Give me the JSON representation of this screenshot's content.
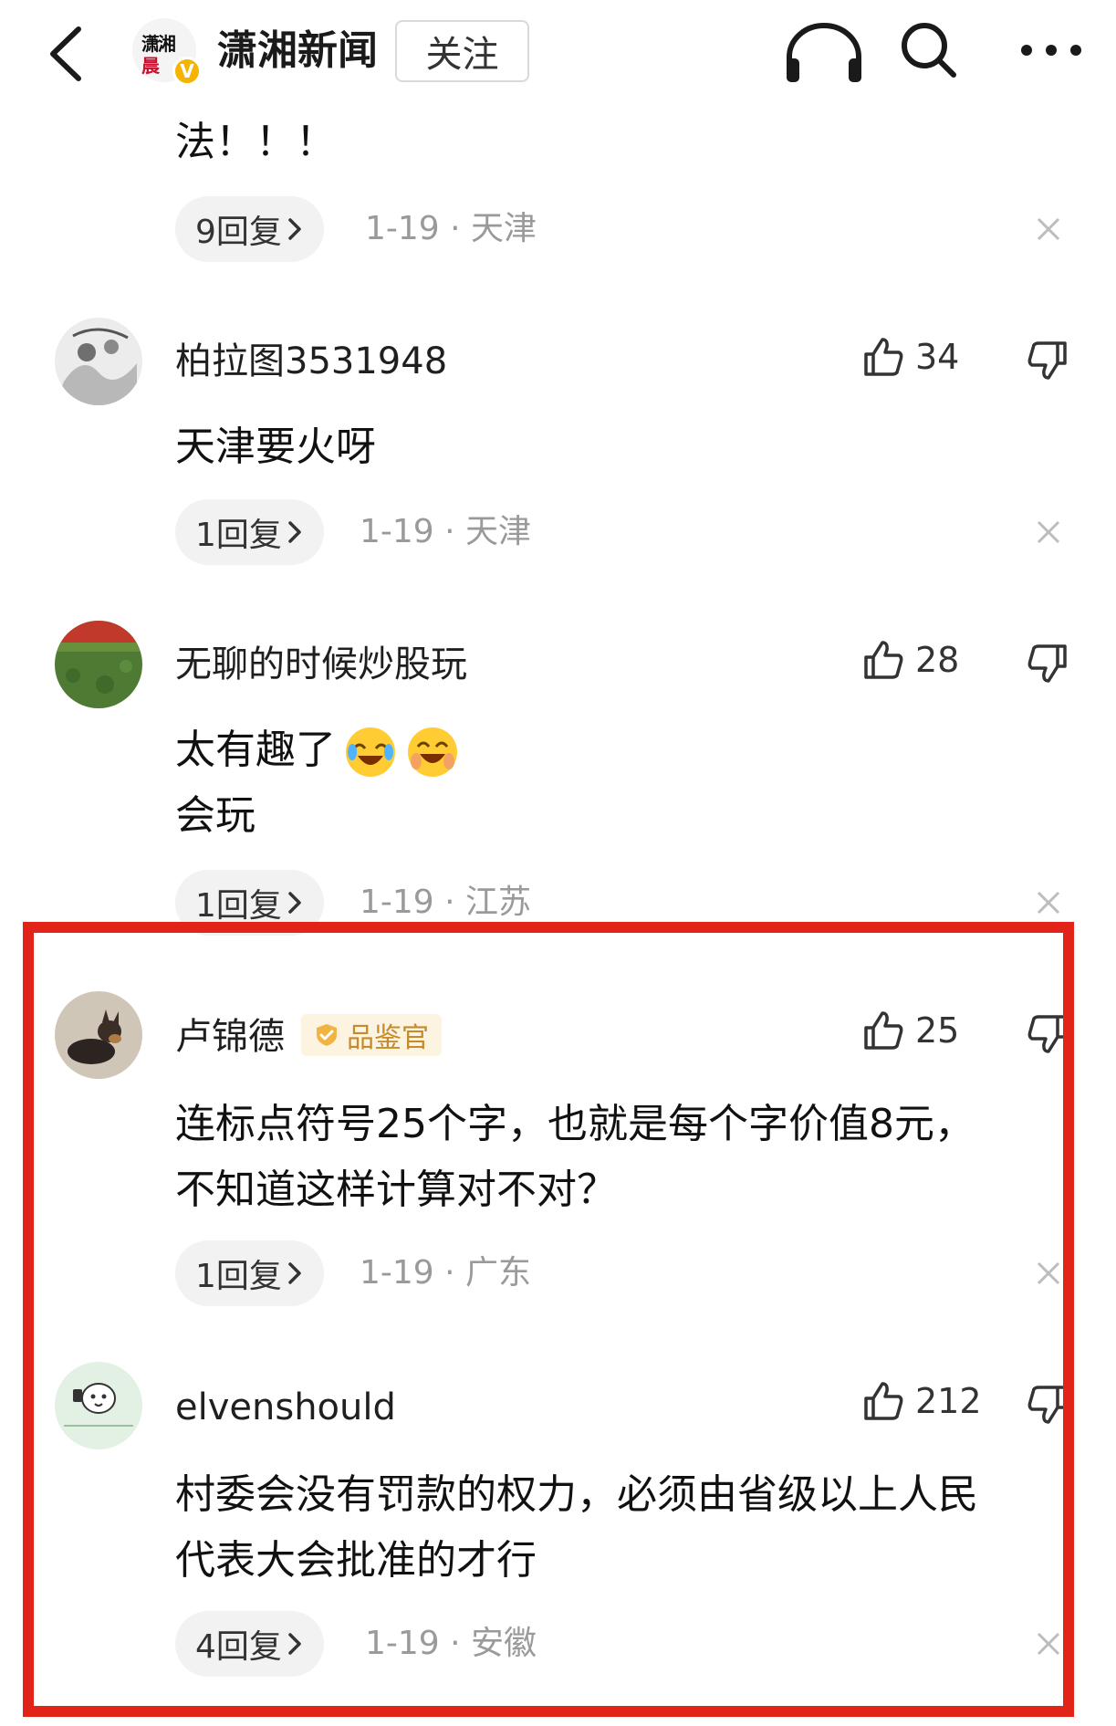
{
  "header": {
    "account_name": "潇湘新闻",
    "follow_label": "关注",
    "logo_text_1": "潇湘",
    "logo_text_2": "晨",
    "verified_badge": "V",
    "icons": [
      "back-chevron-icon",
      "headphones-icon",
      "search-icon",
      "more-icon"
    ]
  },
  "partial_comment": {
    "text_tail": "法！！！",
    "reply_label": "9回复",
    "date": "1-19",
    "location": "天津"
  },
  "comments": [
    {
      "username": "柏拉图3531948",
      "likes": "34",
      "lines": [
        "天津要火呀"
      ],
      "reply_label": "1回复",
      "date": "1-19",
      "location": "天津"
    },
    {
      "username": "无聊的时候炒股玩",
      "likes": "28",
      "lines": [
        "太有趣了",
        "会玩"
      ],
      "emojis": [
        "laughing-crying-emoji",
        "laughing-crying-emoji"
      ],
      "reply_label": "1回复",
      "date": "1-19",
      "location": "江苏"
    },
    {
      "username": "卢锦德",
      "badge": "品鉴官",
      "likes": "25",
      "lines": [
        "连标点符号25个字，也就是每个字价值8元，",
        "不知道这样计算对不对？"
      ],
      "reply_label": "1回复",
      "date": "1-19",
      "location": "广东"
    },
    {
      "username": "elvenshould",
      "likes": "212",
      "lines": [
        "村委会没有罚款的权力，必须由省级以上人民",
        "代表大会批准的才行"
      ],
      "reply_label": "4回复",
      "date": "1-19",
      "location": "安徽"
    }
  ],
  "colors": {
    "highlight_border": "#e2231a",
    "pill_bg": "#f2f2f2",
    "meta_gray": "#9a9a9a",
    "badge_bg": "#fdf3e1",
    "badge_text": "#c58a2a",
    "verified": "#f4b400"
  }
}
